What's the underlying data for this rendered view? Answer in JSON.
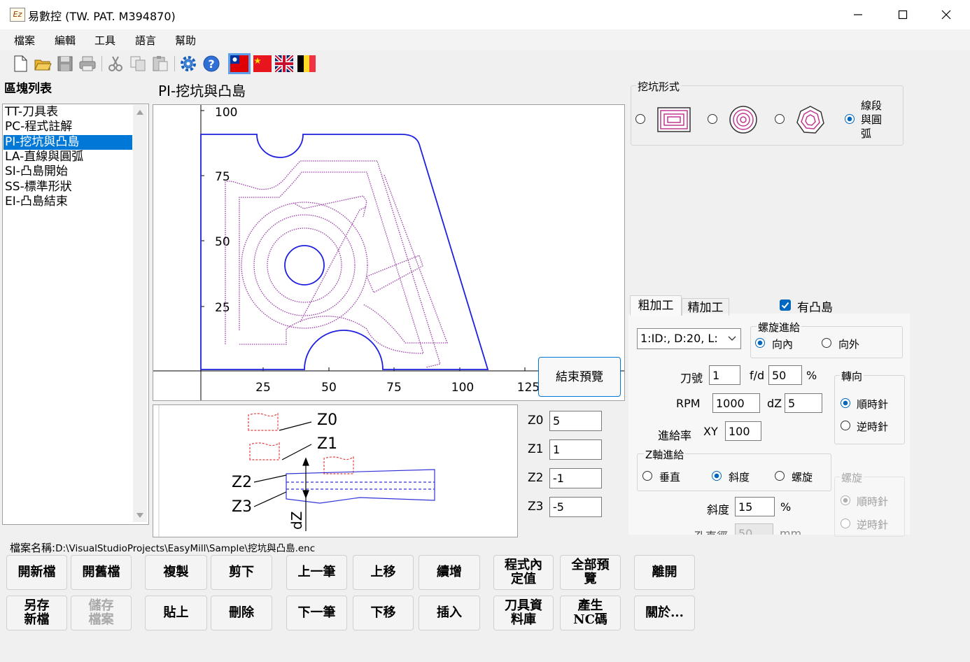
{
  "window": {
    "title": "易數控 (TW. PAT. M394870)",
    "app_icon_text": "Ez"
  },
  "menu": [
    "檔案",
    "編輯",
    "工具",
    "語言",
    "幫助"
  ],
  "blocks": {
    "label": "區塊列表",
    "items": [
      "TT-刀具表",
      "PC-程式註解",
      "PI-挖坑與凸島",
      "LA-直線與圓弧",
      "SI-凸島開始",
      "SS-標準形狀",
      "EI-凸島結束"
    ],
    "selected_index": 2
  },
  "plot": {
    "title": "PI-挖坑與凸島",
    "x_ticks": [
      "25",
      "50",
      "75",
      "100",
      "125"
    ],
    "y_ticks": [
      "25",
      "50",
      "75",
      "100"
    ],
    "end_preview_button": "結束預覽"
  },
  "zdiagram": {
    "labels": [
      "Z0",
      "Z1",
      "Z2",
      "Z3",
      "dZ"
    ]
  },
  "z_fields": [
    {
      "label": "Z0",
      "value": "5"
    },
    {
      "label": "Z1",
      "value": "1"
    },
    {
      "label": "Z2",
      "value": "-1"
    },
    {
      "label": "Z3",
      "value": "-5"
    }
  ],
  "pocket_style": {
    "label": "挖坑形式",
    "line_arc_label": "線段與圓弧",
    "selected": 3
  },
  "tabs": {
    "rough": "粗加工",
    "finish": "精加工",
    "active": "rough"
  },
  "has_island": {
    "label": "有凸島",
    "checked": true
  },
  "tool_select": {
    "value": "1:ID:, D:20, L:"
  },
  "spiral_feed": {
    "label": "螺旋進給",
    "inward": "向內",
    "outward": "向外",
    "selected": "inward"
  },
  "params": {
    "tool_no_label": "刀號",
    "tool_no": "1",
    "fd_label": "f/d",
    "fd": "50",
    "fd_unit": "%",
    "rpm_label": "RPM",
    "rpm": "1000",
    "dz_label": "dZ",
    "dz": "5",
    "feed_label": "進給率",
    "xy_label": "XY",
    "xy": "100"
  },
  "direction": {
    "label": "轉向",
    "cw": "順時針",
    "ccw": "逆時針",
    "selected": "cw"
  },
  "z_feed": {
    "label": "Z軸進給",
    "vertical": "垂直",
    "slope": "斜度",
    "spiral": "螺旋",
    "selected": "slope"
  },
  "slope": {
    "label": "斜度",
    "value": "15",
    "unit": "%"
  },
  "spiral_dir": {
    "label": "螺旋",
    "cw": "順時針",
    "ccw": "逆時針",
    "selected": "cw"
  },
  "partial_row": {
    "label": "孔直徑",
    "value": "50",
    "unit": "mm"
  },
  "filename": {
    "label": "檔案名稱:",
    "path": "D:\\VisualStudioProjects\\EasyMill\\Sample\\挖坑與凸島.enc"
  },
  "buttons": {
    "new": "開新檔",
    "open": "開舊檔",
    "copy": "複製",
    "cut": "剪下",
    "prev": "上一筆",
    "move_up": "上移",
    "append": "續增",
    "defaults": "程式內定值",
    "preview_all": "全部預覽",
    "exit": "離開",
    "save_as": "另存新檔",
    "save": "儲存檔案",
    "paste": "貼上",
    "delete": "刪除",
    "next": "下一筆",
    "move_down": "下移",
    "insert": "插入",
    "tool_db": "刀具資料庫",
    "gen_nc": "產生NC碼",
    "about": "關於..."
  },
  "colors": {
    "selection": "#0078d7",
    "toolpath": "#9a3aa8",
    "contour": "#1f1fe0",
    "zdiagram_red": "#e04040",
    "zdiagram_blue": "#3232d8"
  }
}
